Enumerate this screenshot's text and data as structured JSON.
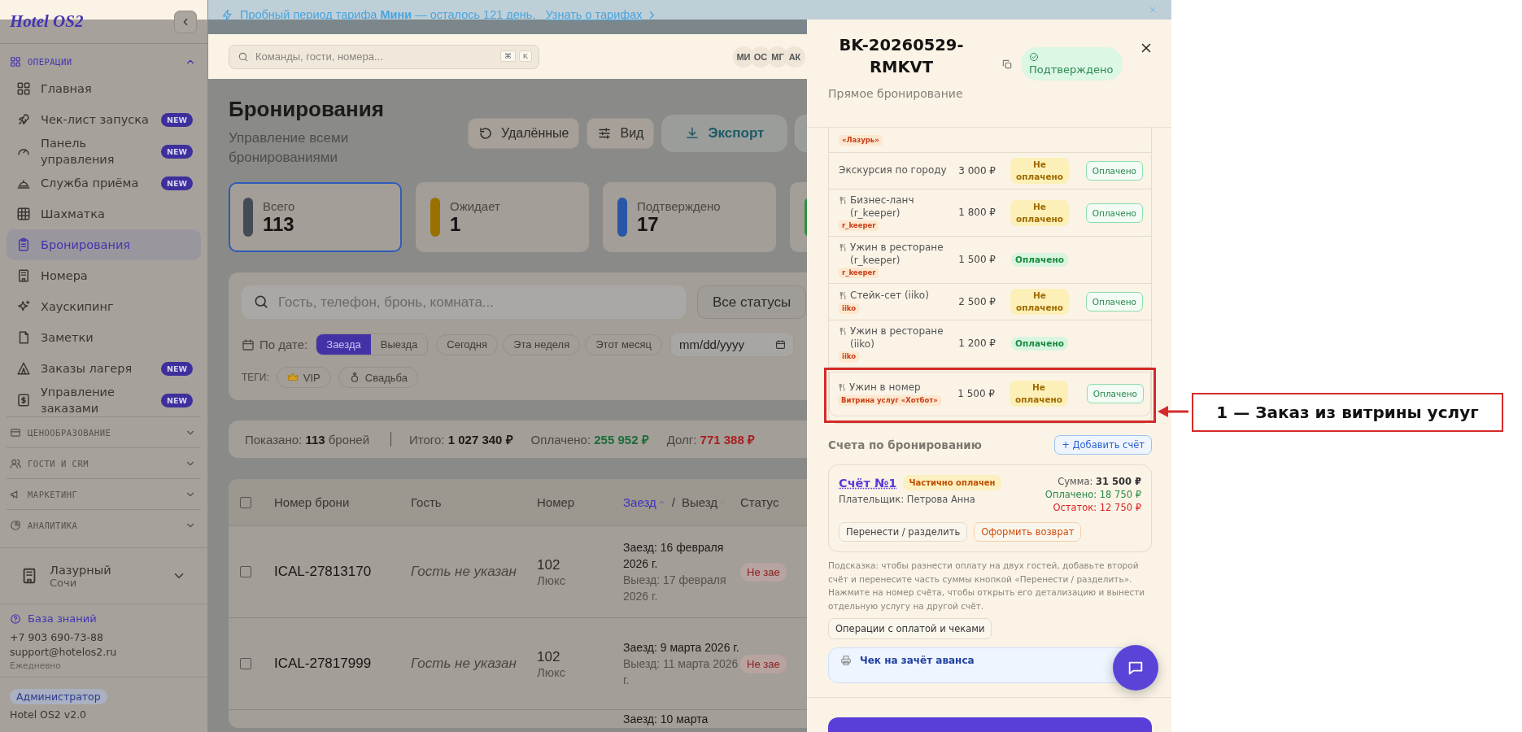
{
  "sidebar": {
    "logo": "Hotel OS2",
    "sections": [
      {
        "title": "ОПЕРАЦИИ",
        "expanded": true,
        "items": [
          {
            "label": "Главная",
            "selected": false
          },
          {
            "label": "Чек-лист запуска",
            "badge": "NEW",
            "selected": false
          },
          {
            "label": "Панель управления",
            "badge": "NEW",
            "selected": false
          },
          {
            "label": "Служба приёма",
            "badge": "NEW",
            "selected": false
          },
          {
            "label": "Шахматка",
            "selected": false
          },
          {
            "label": "Бронирования",
            "selected": true
          },
          {
            "label": "Номера",
            "selected": false
          },
          {
            "label": "Хаускипинг",
            "selected": false
          },
          {
            "label": "Заметки",
            "selected": false
          },
          {
            "label": "Заказы лагеря",
            "badge": "NEW",
            "selected": false
          },
          {
            "label": "Управление заказами",
            "badge": "NEW",
            "selected": false
          }
        ]
      },
      {
        "title": "ЦЕНООБРАЗОВАНИЕ",
        "expanded": false
      },
      {
        "title": "ГОСТИ И CRM",
        "expanded": false
      },
      {
        "title": "МАРКЕТИНГ",
        "expanded": false
      },
      {
        "title": "АНАЛИТИКА",
        "expanded": false
      }
    ],
    "property": {
      "name": "Лазурный",
      "city": "Сочи"
    },
    "support": {
      "link": "База знаний",
      "phone": "+7 903 690-73-88",
      "email": "support@hotelos2.ru",
      "hours": "Ежедневно"
    },
    "role": "Администратор",
    "version": "Hotel OS2 v2.0"
  },
  "banner": {
    "text": "Пробный период тарифа **Мини** — осталось 121 день.",
    "link": "Узнать о тарифах"
  },
  "header": {
    "search": {
      "placeholder": "Команды, гости, номера..."
    },
    "shortcut_keys": [
      "⌘",
      "K"
    ],
    "avatars": [
      "МИ",
      "ОС",
      "МГ",
      "АК"
    ]
  },
  "page": {
    "title": "Бронирования",
    "subtitle": "Управление всеми бронированиями",
    "buttons": [
      {
        "label": "Удалённые",
        "kind": "ghost"
      },
      {
        "label": "Вид",
        "kind": "ghost"
      },
      {
        "label": "Экспорт",
        "kind": "export"
      },
      {
        "kind": "partial"
      }
    ]
  },
  "stat_cards": [
    {
      "label": "Всего",
      "value": "113",
      "color": "#454a57",
      "selected": true
    },
    {
      "label": "Ожидает",
      "value": "1",
      "color": "#9a7000",
      "selected": false
    },
    {
      "label": "Подтверждено",
      "value": "17",
      "color": "#2a56a8",
      "selected": false
    },
    {
      "color": "#2c8f46",
      "selected": false
    }
  ],
  "filters": {
    "search": {
      "placeholder": "Гость, телефон, бронь, комната..."
    },
    "status_select": "Все статусы",
    "date_label": "По дате:",
    "date_modes": [
      {
        "label": "Заезда",
        "selected": true
      },
      {
        "label": "Выезда",
        "selected": false
      }
    ],
    "quick_ranges": [
      "Сегодня",
      "Эта неделя",
      "Этот месяц"
    ],
    "date_input": {
      "placeholder": "mm/dd/yyyy"
    },
    "tags_label": "ТЕГИ:",
    "tags": [
      "VIP",
      "Свадьба"
    ]
  },
  "summary": {
    "shown": "Показано: **113** броней",
    "totals": [
      {
        "label": "Итого:",
        "value": "1 027 340 ₽",
        "kind": "total"
      },
      {
        "label": "Оплачено:",
        "value": "255 952 ₽",
        "kind": "paid"
      },
      {
        "label": "Долг:",
        "value": "771 388 ₽",
        "kind": "debt"
      }
    ]
  },
  "table": {
    "select_all": {
      "checked": false
    },
    "columns": [
      "Номер брони",
      "Гость",
      "Номер"
    ],
    "date_sort": [
      {
        "label": "Заезд",
        "selected": true
      },
      {
        "label": "Выезд",
        "selected": false
      }
    ],
    "date_sort_separator": "/",
    "status_column": "Статус",
    "rows": [
      {
        "booking": "ICAL-27813170",
        "guest": "Гость не указан",
        "room": "102",
        "room_type": "Люкс",
        "checkin": "Заезд: 16 февраля 2026 г.",
        "checkout": "Выезд: 17 февраля 2026 г.",
        "status": "Не зае",
        "selected": false
      },
      {
        "booking": "ICAL-27817999",
        "guest": "Гость не указан",
        "room": "102",
        "room_type": "Люкс",
        "checkin": "Заезд: 9 марта 2026 г.",
        "checkout": "Выезд: 11 марта 2026 г.",
        "status": "Не зае",
        "selected": false
      },
      {
        "checkin": "Заезд: 10 марта"
      }
    ]
  },
  "drawer": {
    "title": "BK-20260529-RMKVT",
    "status": "Подтверждено",
    "subtitle": "Прямое бронирование",
    "services": [
      {
        "kind": "partial",
        "tag": "«Лазурь»"
      },
      {
        "kind": "service",
        "name": "Экскурсия по городу",
        "price": "3 000 ₽",
        "status": "Не оплачено",
        "paid": false,
        "action": "Оплачено",
        "highlighted": false
      },
      {
        "kind": "restaurant",
        "name": "Бизнес-ланч (r_keeper)",
        "tag": "r_keeper",
        "price": "1 800 ₽",
        "status": "Не оплачено",
        "paid": false,
        "action": "Оплачено",
        "highlighted": false
      },
      {
        "kind": "restaurant",
        "name": "Ужин в ресторане (r_keeper)",
        "tag": "r_keeper",
        "price": "1 500 ₽",
        "status": "Оплачено",
        "paid": true,
        "highlighted": false
      },
      {
        "kind": "restaurant",
        "name": "Стейк-сет (iiko)",
        "tag": "iiko",
        "price": "2 500 ₽",
        "status": "Не оплачено",
        "paid": false,
        "action": "Оплачено",
        "highlighted": false
      },
      {
        "kind": "restaurant",
        "name": "Ужин в ресторане (iiko)",
        "tag": "iiko",
        "price": "1 200 ₽",
        "status": "Оплачено",
        "paid": true,
        "highlighted": false
      },
      {
        "kind": "restaurant",
        "name": "Ужин в номер",
        "tag": "Витрина услуг «Хотбот»",
        "price": "1 500 ₽",
        "status": "Не оплачено",
        "paid": false,
        "action": "Оплачено",
        "highlighted": true
      }
    ],
    "invoices_title": "Счета по бронированию",
    "add_invoice": "+ Добавить счёт",
    "invoices": [
      {
        "number": "Счёт №1",
        "status": "Частично оплачен",
        "payer": "Плательщик: Петрова Анна",
        "total": "Сумма: **31 500 ₽**",
        "paid": "Оплачено: 18 750 ₽",
        "remaining": "Остаток: 12 750 ₽",
        "actions": [
          {
            "label": "Перенести / разделить",
            "kind": "neutral"
          },
          {
            "label": "Оформить возврат",
            "kind": "refund"
          }
        ]
      }
    ],
    "hint": "Подсказка: чтобы разнести оплату на двух гостей, добавьте второй счёт и перенесите часть суммы кнопкой «Перенести / разделить». Нажмите на номер счёта, чтобы открыть его детализацию и вынести отдельную услугу на другой счёт.",
    "operations_button": "Операции с оплатой и чеками",
    "receipt": {
      "title": "Чек на зачёт аванса"
    }
  },
  "annotation": {
    "text": "1 — Заказ из витрины услуг"
  }
}
